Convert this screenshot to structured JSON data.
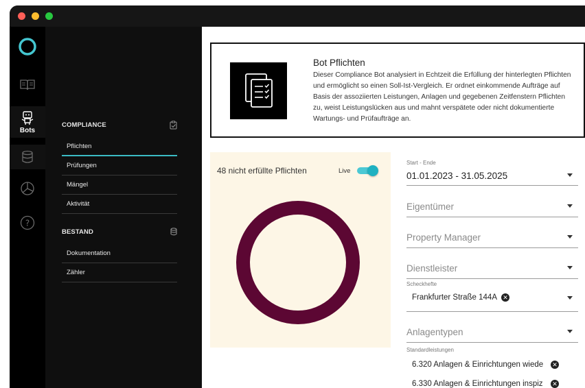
{
  "rail": {
    "bots_label": "Bots"
  },
  "sidebar": {
    "compliance": {
      "title": "COMPLIANCE",
      "items": [
        "Pflichten",
        "Prüfungen",
        "Mängel",
        "Aktivität"
      ]
    },
    "bestand": {
      "title": "BESTAND",
      "items": [
        "Dokumentation",
        "Zähler"
      ]
    }
  },
  "info": {
    "title": "Bot Pflichten",
    "description": "Dieser Compliance Bot analysiert in Echtzeit die Erfüllung der hinterlegten Pflichten und ermöglicht so einen Soll-Ist-Vergleich. Er ordnet einkommende Aufträge auf Basis der assoziierten Leistungen, Anlagen und gegebenen Zeitfenstern Pflichten zu, weist Leistungslücken aus und mahnt verspätete oder nicht dokumentierte Wartungs- und Prüfaufträge an."
  },
  "chart": {
    "title": "48 nicht erfüllte Pflichten",
    "live_label": "Live",
    "live_on": true
  },
  "chart_data": {
    "type": "pie",
    "categories": [
      "nicht erfüllte Pflichten"
    ],
    "values": [
      48
    ],
    "title": "48 nicht erfüllte Pflichten",
    "color": "#5c0733"
  },
  "filters": {
    "date": {
      "label": "Start - Ende",
      "value": "01.01.2023 - 31.05.2025"
    },
    "owner": {
      "placeholder": "Eigentümer"
    },
    "property_manager": {
      "placeholder": "Property Manager"
    },
    "service_provider": {
      "placeholder": "Dienstleister"
    },
    "checkbooks": {
      "label": "Scheckhefte",
      "chips": [
        "Frankfurter Straße 144A"
      ]
    },
    "asset_types": {
      "placeholder": "Anlagentypen"
    },
    "standard_services": {
      "label": "Standardleistungen",
      "chips": [
        "6.320 Anlagen & Einrichtungen wiede",
        "6.330 Anlagen & Einrichtungen inspiz"
      ]
    }
  },
  "colors": {
    "accent": "#3bbcc5",
    "donut": "#5c0733",
    "chart_bg": "#fdf6e6"
  }
}
